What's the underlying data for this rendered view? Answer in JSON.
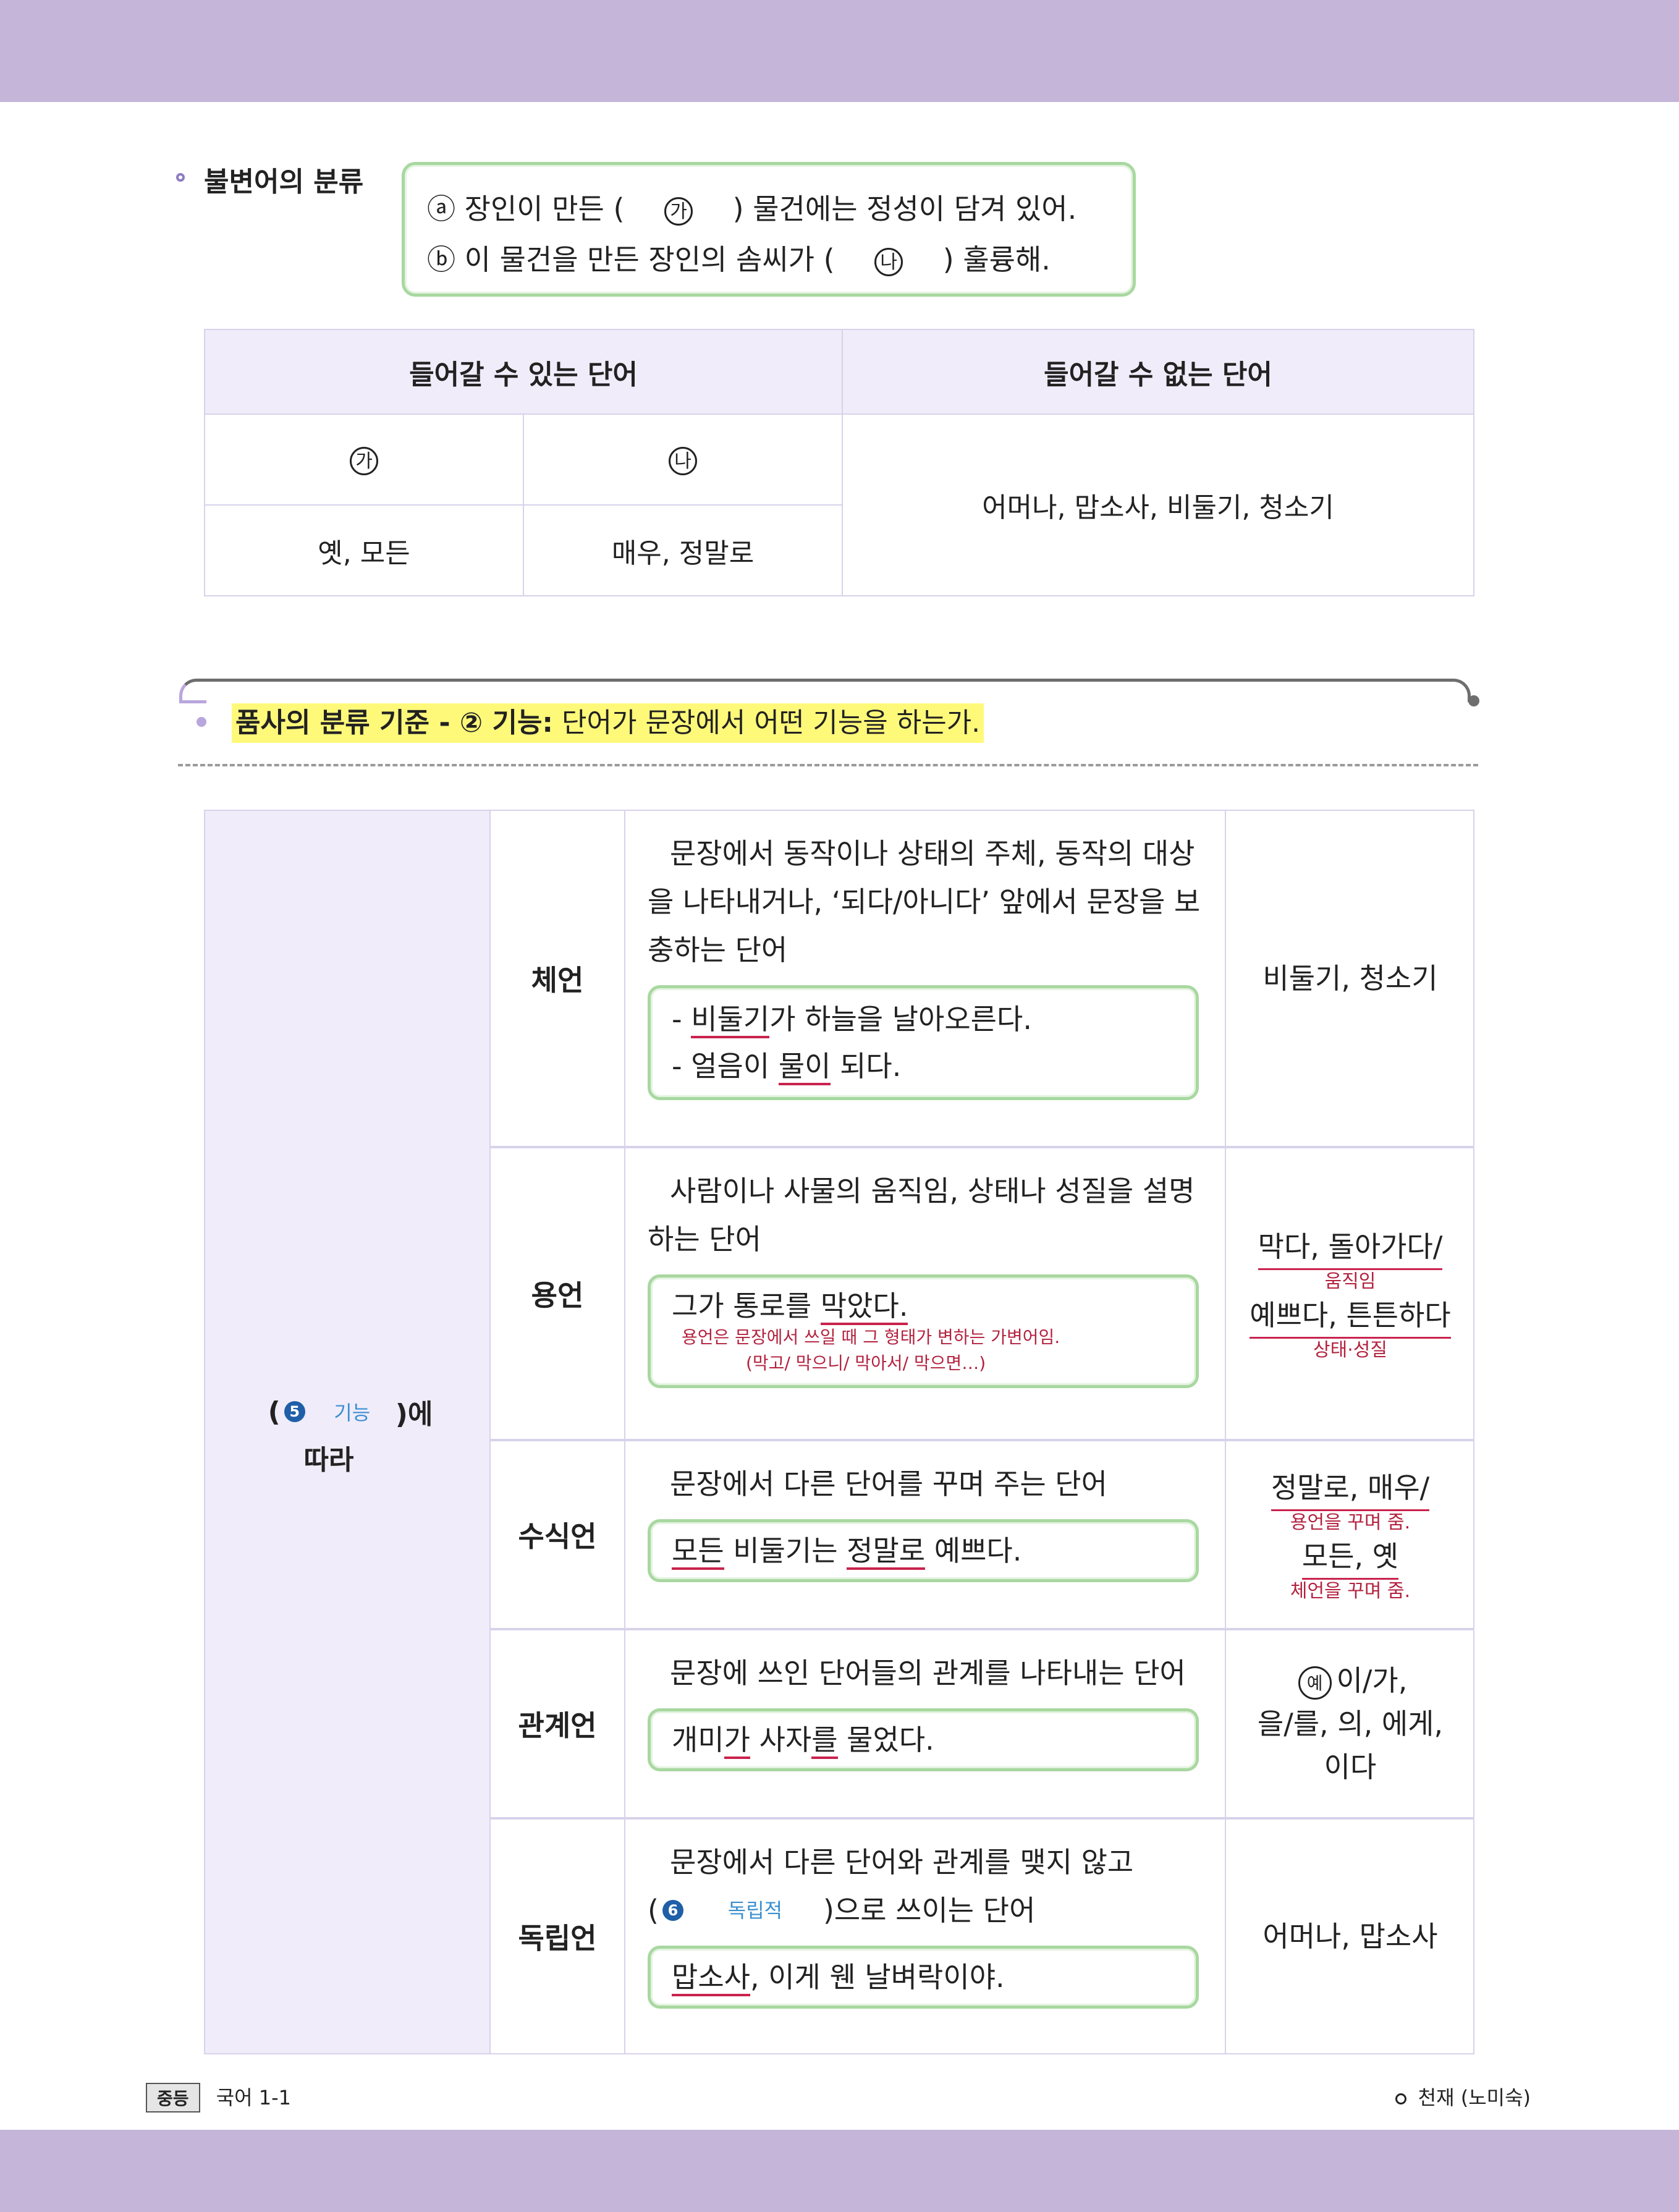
{
  "section1": {
    "title": "불변어의 분류",
    "example_a": "장인이 만든 (",
    "example_a_mark": "ⓐ",
    "blank_ga": "가",
    "example_a_end": ") 물건에는 정성이 담겨 있어.",
    "example_b_mark": "ⓑ",
    "example_b": "이 물건을 만든 장인의 솜씨가 (",
    "blank_na": "나",
    "example_b_end": ") 훌륭해.",
    "table": {
      "col1": "들어갈 수 있는 단어",
      "col2": "들어갈 수 없는 단어",
      "sub_ga": "가",
      "sub_na": "나",
      "val_ga": "옛, 모든",
      "val_na": "매우, 정말로",
      "val_cannot": "어머나, 맙소사, 비둘기, 청소기"
    }
  },
  "section2": {
    "heading_bold": "품사의 분류 기준 - ② 기능:",
    "heading_rest": "단어가 문장에서 어떤 기능을 하는가.",
    "left_num": "5",
    "left_answer": "기능",
    "left_suffix": ")에",
    "left_line2": "따라",
    "left_open": "(",
    "rows": [
      {
        "category": "체언",
        "desc": "문장에서 동작이나 상태의 주체, 동작의 대상을 나타내거나, ‘되다/아니다’ 앞에서 문장을 보충하는 단어",
        "ex1_pre": "- ",
        "ex1_ul": "비둘기",
        "ex1_post": "가 하늘을 날아오른다.",
        "ex2_pre": "- 얼음이 ",
        "ex2_ul": "물이",
        "ex2_post": " 되다.",
        "answer": "비둘기, 청소기"
      },
      {
        "category": "용언",
        "desc": "사람이나 사물의 움직임, 상태나 성질을 설명하는 단어",
        "ex_pre": "그가 통로를 ",
        "ex_ul": "막았다.",
        "note1": "용언은 문장에서 쓰일 때 그 형태가 변하는 가변어임.",
        "note2": "(막고/ 막으니/ 막아서/ 막으면…)",
        "answer1": "막다, 돌아가다/",
        "answer1_note": "움직임",
        "answer2": "예쁘다, 튼튼하다",
        "answer2_note": "상태·성질"
      },
      {
        "category": "수식언",
        "desc": "문장에서 다른 단어를 꾸며 주는 단어",
        "ex_ul1": "모든",
        "ex_mid1": " 비둘기는 ",
        "ex_ul2": "정말로",
        "ex_end": " 예쁘다.",
        "answer1": "정말로, 매우/",
        "answer1_note": "용언을 꾸며 줌.",
        "answer2": "모든, 옛",
        "answer2_note": "체언을 꾸며 줌."
      },
      {
        "category": "관계언",
        "desc": "문장에 쓰인 단어들의 관계를 나타내는 단어",
        "ex_pre": "개미",
        "ex_ul1": "가",
        "ex_mid": " 사자",
        "ex_ul2": "를",
        "ex_end": " 물었다.",
        "answer_mark": "예",
        "answer1": "이/가,",
        "answer2": "을/를, 의, 에게,",
        "answer3": "이다"
      },
      {
        "category": "독립언",
        "desc1": "문장에서 다른 단어와 관계를 맺지 않고",
        "desc2_open": "(",
        "desc2_num": "6",
        "desc2_answer": "독립적",
        "desc2_end": ")으로 쓰이는 단어",
        "ex_ul": "맙소사",
        "ex_end": ", 이게 웬 날벼락이야.",
        "answer": "어머나, 맙소사"
      }
    ]
  },
  "footer": {
    "badge": "중등",
    "subject": "국어 1-1",
    "publisher": "천재 (노미숙)"
  }
}
